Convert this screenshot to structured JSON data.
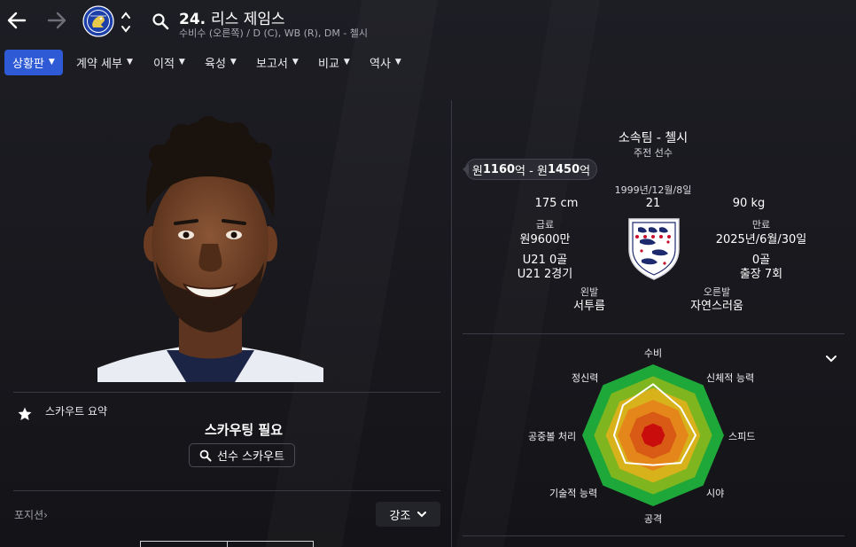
{
  "header": {
    "number": "24.",
    "name": "리스 제임스",
    "subtitle": "수비수 (오른쪽) / D (C), WB (R), DM - 첼시"
  },
  "tabs": [
    {
      "label": "상황판",
      "active": true
    },
    {
      "label": "계약 세부"
    },
    {
      "label": "이적"
    },
    {
      "label": "육성"
    },
    {
      "label": "보고서"
    },
    {
      "label": "비교"
    },
    {
      "label": "역사"
    }
  ],
  "scout": {
    "summary_label": "스카우트 요약",
    "status": "스카우팅 필요",
    "button_label": "선수 스카우트"
  },
  "position": {
    "label": "포지션",
    "arrow": "›"
  },
  "emphasis": {
    "label": "강조"
  },
  "info": {
    "club_line": "소속팀 - 첼시",
    "role": "주전 선수",
    "value_prefix": "원",
    "value_low": "1160",
    "value_mid": "억 - 원",
    "value_high": "1450",
    "value_suffix": "억",
    "dob": "1999년/12월/8일",
    "height": "175 cm",
    "age": "21",
    "weight": "90 kg",
    "wage_label": "급료",
    "wage": "원9600만",
    "expiry_label": "만료",
    "expiry": "2025년/6월/30일",
    "u21_goals": "U21 0골",
    "u21_caps": "U21 2경기",
    "goals": "0골",
    "appearances": "출장 7회",
    "left_foot_label": "왼발",
    "left_foot": "서투름",
    "right_foot_label": "오른발",
    "right_foot": "자연스러움"
  },
  "radar": {
    "labels": [
      "수비",
      "신체적 능력",
      "스피드",
      "시야",
      "공격",
      "기술적 능력",
      "공중볼 처리",
      "정신력"
    ],
    "values": [
      0.72,
      0.55,
      0.6,
      0.55,
      0.42,
      0.55,
      0.55,
      0.6
    ],
    "ring_colors": [
      "#1fa83a",
      "#7fb51f",
      "#d7b21b",
      "#e5861b",
      "#d85a14",
      "#c90d0d"
    ]
  },
  "colors": {
    "accent": "#2f5ad6",
    "background": "#16161b"
  }
}
